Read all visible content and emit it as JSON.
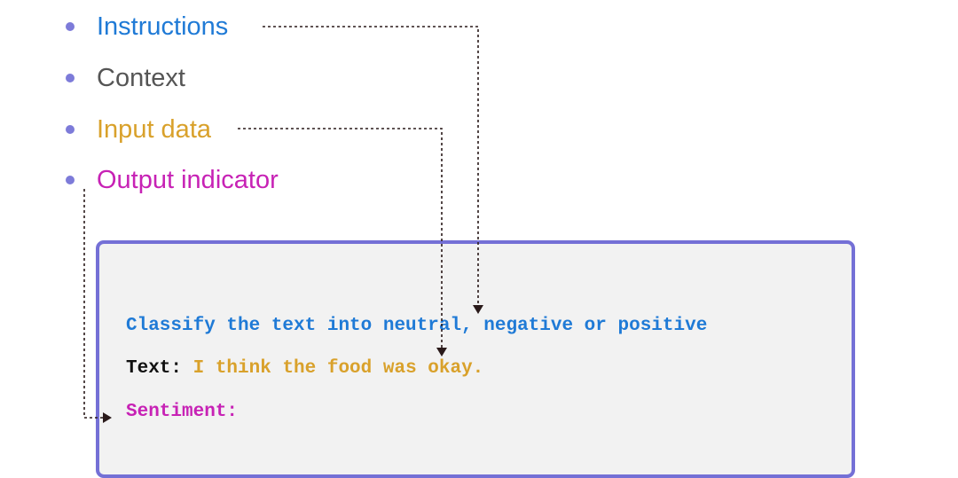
{
  "legend": {
    "items": [
      {
        "label": "Instructions",
        "color": "#1f7ad6"
      },
      {
        "label": "Context",
        "color": "#555555"
      },
      {
        "label": "Input data",
        "color": "#d9a12b"
      },
      {
        "label": "Output indicator",
        "color": "#c722b5"
      }
    ],
    "bullet_color": "#7d7bd9"
  },
  "prompt": {
    "instruction": "Classify the text into neutral, negative or positive",
    "input_prefix": "Text: ",
    "input_value": "I think the food was okay.",
    "output_label": "Sentiment:",
    "border_color": "#7470d6",
    "background": "#f2f2f2",
    "prefix_color": "#111111"
  },
  "connector_color": "#2a1a1a"
}
